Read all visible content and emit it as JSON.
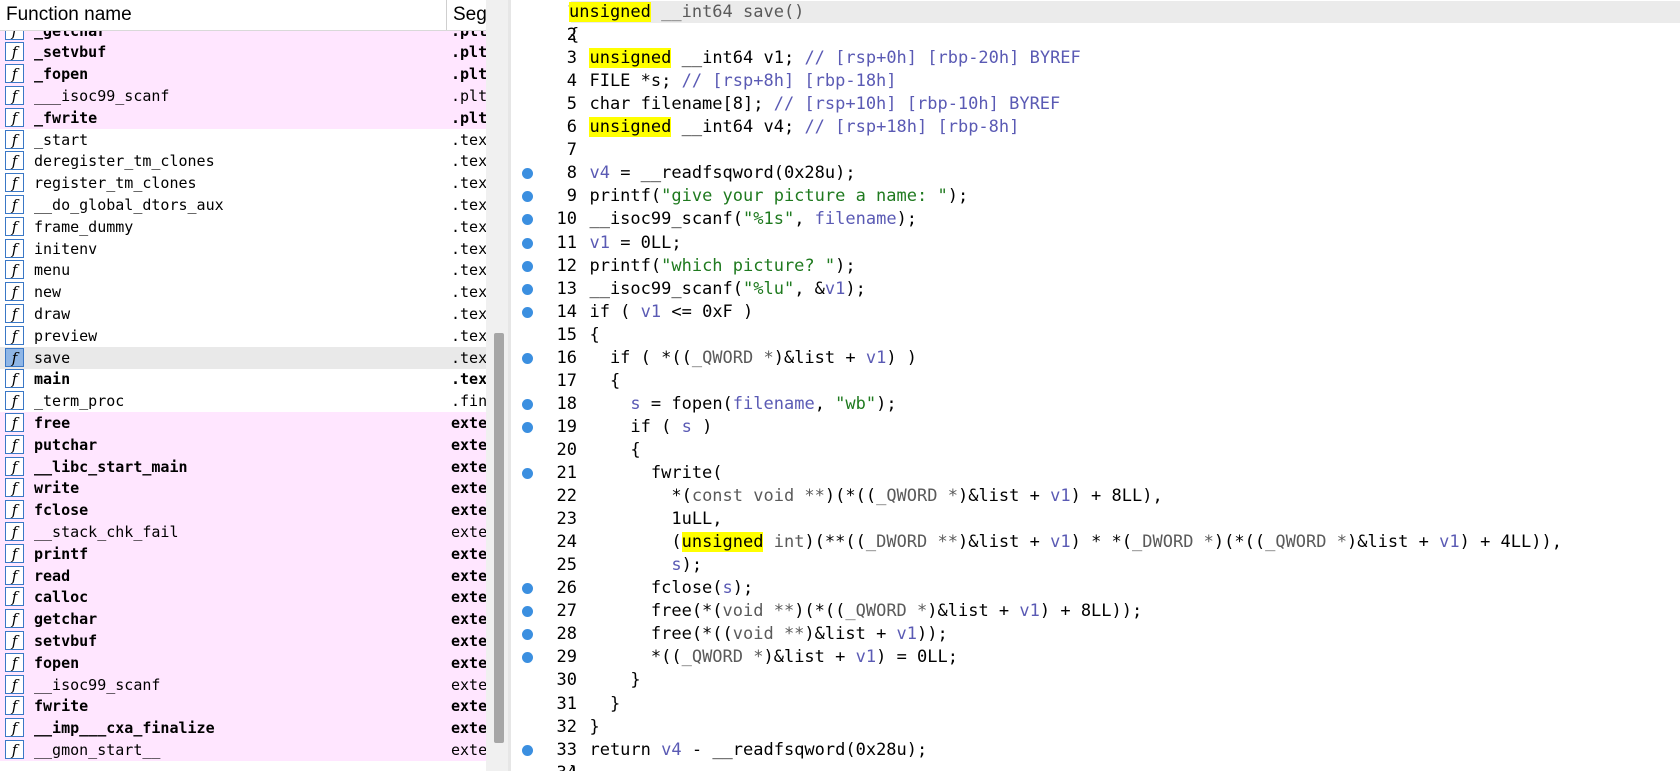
{
  "function_list": {
    "headers": {
      "name": "Function name",
      "segment": "Segment"
    },
    "rows": [
      {
        "name": "_getchar",
        "segment": ".plt",
        "bold": true,
        "style": "pink"
      },
      {
        "name": "_setvbuf",
        "segment": ".plt",
        "bold": true,
        "style": "pink"
      },
      {
        "name": "_fopen",
        "segment": ".plt",
        "bold": true,
        "style": "pink"
      },
      {
        "name": "___isoc99_scanf",
        "segment": ".plt",
        "bold": false,
        "style": "pink"
      },
      {
        "name": "_fwrite",
        "segment": ".plt",
        "bold": true,
        "style": "pink"
      },
      {
        "name": "_start",
        "segment": ".text",
        "bold": false,
        "style": "plain"
      },
      {
        "name": "deregister_tm_clones",
        "segment": ".text",
        "bold": false,
        "style": "plain"
      },
      {
        "name": "register_tm_clones",
        "segment": ".text",
        "bold": false,
        "style": "plain"
      },
      {
        "name": "__do_global_dtors_aux",
        "segment": ".text",
        "bold": false,
        "style": "plain"
      },
      {
        "name": "frame_dummy",
        "segment": ".text",
        "bold": false,
        "style": "plain"
      },
      {
        "name": "initenv",
        "segment": ".text",
        "bold": false,
        "style": "plain"
      },
      {
        "name": "menu",
        "segment": ".text",
        "bold": false,
        "style": "plain"
      },
      {
        "name": "new",
        "segment": ".text",
        "bold": false,
        "style": "plain"
      },
      {
        "name": "draw",
        "segment": ".text",
        "bold": false,
        "style": "plain"
      },
      {
        "name": "preview",
        "segment": ".text",
        "bold": false,
        "style": "plain"
      },
      {
        "name": "save",
        "segment": ".text",
        "bold": false,
        "style": "selected"
      },
      {
        "name": "main",
        "segment": ".text",
        "bold": true,
        "style": "plain"
      },
      {
        "name": "_term_proc",
        "segment": ".fini",
        "bold": false,
        "style": "plain"
      },
      {
        "name": "free",
        "segment": "extern",
        "bold": true,
        "style": "pink"
      },
      {
        "name": "putchar",
        "segment": "extern",
        "bold": true,
        "style": "pink"
      },
      {
        "name": "__libc_start_main",
        "segment": "extern",
        "bold": true,
        "style": "pink"
      },
      {
        "name": "write",
        "segment": "extern",
        "bold": true,
        "style": "pink"
      },
      {
        "name": "fclose",
        "segment": "extern",
        "bold": true,
        "style": "pink"
      },
      {
        "name": "__stack_chk_fail",
        "segment": "extern",
        "bold": false,
        "style": "pink"
      },
      {
        "name": "printf",
        "segment": "extern",
        "bold": true,
        "style": "pink"
      },
      {
        "name": "read",
        "segment": "extern",
        "bold": true,
        "style": "pink"
      },
      {
        "name": "calloc",
        "segment": "extern",
        "bold": true,
        "style": "pink"
      },
      {
        "name": "getchar",
        "segment": "extern",
        "bold": true,
        "style": "pink"
      },
      {
        "name": "setvbuf",
        "segment": "extern",
        "bold": true,
        "style": "pink"
      },
      {
        "name": "fopen",
        "segment": "extern",
        "bold": true,
        "style": "pink"
      },
      {
        "name": "__isoc99_scanf",
        "segment": "extern",
        "bold": false,
        "style": "pink"
      },
      {
        "name": "fwrite",
        "segment": "extern",
        "bold": true,
        "style": "pink"
      },
      {
        "name": "__imp___cxa_finalize",
        "segment": "extern",
        "bold": true,
        "style": "pink"
      },
      {
        "name": "__gmon_start__",
        "segment": "extern",
        "bold": false,
        "style": "pink"
      }
    ]
  },
  "pseudocode": {
    "current_line": 1,
    "lines": [
      {
        "n": "1",
        "bp": false,
        "t": [
          [
            "unsigned",
            "kwhl"
          ],
          [
            " __int64 save()",
            "typ"
          ]
        ]
      },
      {
        "n": "2",
        "bp": false,
        "t": [
          [
            "{",
            ""
          ]
        ]
      },
      {
        "n": "3",
        "bp": false,
        "t": [
          [
            "  ",
            ""
          ],
          [
            "unsigned",
            "kwhl"
          ],
          [
            " __int64 v1; ",
            ""
          ],
          [
            "// [rsp+0h] [rbp-20h] BYREF",
            "cmt"
          ]
        ]
      },
      {
        "n": "4",
        "bp": false,
        "t": [
          [
            "  FILE *s; ",
            ""
          ],
          [
            "// [rsp+8h] [rbp-18h]",
            "cmt"
          ]
        ]
      },
      {
        "n": "5",
        "bp": false,
        "t": [
          [
            "  char filename[8]; ",
            ""
          ],
          [
            "// [rsp+10h] [rbp-10h] BYREF",
            "cmt"
          ]
        ]
      },
      {
        "n": "6",
        "bp": false,
        "t": [
          [
            "  ",
            ""
          ],
          [
            "unsigned",
            "kwhl"
          ],
          [
            " __int64 v4; ",
            ""
          ],
          [
            "// [rsp+18h] [rbp-8h]",
            "cmt"
          ]
        ]
      },
      {
        "n": "7",
        "bp": false,
        "t": [
          [
            "",
            ""
          ]
        ]
      },
      {
        "n": "8",
        "bp": true,
        "t": [
          [
            "  ",
            ""
          ],
          [
            "v4",
            "var"
          ],
          [
            " = __readfsqword(0x28u);",
            ""
          ]
        ]
      },
      {
        "n": "9",
        "bp": true,
        "t": [
          [
            "  printf(",
            ""
          ],
          [
            "\"give your picture a name: \"",
            "str"
          ],
          [
            ");",
            ""
          ]
        ]
      },
      {
        "n": "10",
        "bp": true,
        "t": [
          [
            "  __isoc99_scanf(",
            ""
          ],
          [
            "\"%1s\"",
            "str"
          ],
          [
            ", ",
            ""
          ],
          [
            "filename",
            "var"
          ],
          [
            ");",
            ""
          ]
        ]
      },
      {
        "n": "11",
        "bp": true,
        "t": [
          [
            "  ",
            ""
          ],
          [
            "v1",
            "var"
          ],
          [
            " = 0LL;",
            ""
          ]
        ]
      },
      {
        "n": "12",
        "bp": true,
        "t": [
          [
            "  printf(",
            ""
          ],
          [
            "\"which picture? \"",
            "str"
          ],
          [
            ");",
            ""
          ]
        ]
      },
      {
        "n": "13",
        "bp": true,
        "t": [
          [
            "  __isoc99_scanf(",
            ""
          ],
          [
            "\"%lu\"",
            "str"
          ],
          [
            ", &",
            ""
          ],
          [
            "v1",
            "var"
          ],
          [
            ");",
            ""
          ]
        ]
      },
      {
        "n": "14",
        "bp": true,
        "t": [
          [
            "  if ( ",
            ""
          ],
          [
            "v1",
            "var"
          ],
          [
            " <= 0xF )",
            ""
          ]
        ]
      },
      {
        "n": "15",
        "bp": false,
        "t": [
          [
            "  {",
            ""
          ]
        ]
      },
      {
        "n": "16",
        "bp": true,
        "t": [
          [
            "    if ( *((",
            ""
          ],
          [
            "_QWORD *",
            "typ"
          ],
          [
            ")&list + ",
            ""
          ],
          [
            "v1",
            "var"
          ],
          [
            ") )",
            ""
          ]
        ]
      },
      {
        "n": "17",
        "bp": false,
        "t": [
          [
            "    {",
            ""
          ]
        ]
      },
      {
        "n": "18",
        "bp": true,
        "t": [
          [
            "      ",
            ""
          ],
          [
            "s",
            "var"
          ],
          [
            " = fopen(",
            ""
          ],
          [
            "filename",
            "var"
          ],
          [
            ", ",
            ""
          ],
          [
            "\"wb\"",
            "str"
          ],
          [
            ");",
            ""
          ]
        ]
      },
      {
        "n": "19",
        "bp": true,
        "t": [
          [
            "      if ( ",
            ""
          ],
          [
            "s",
            "var"
          ],
          [
            " )",
            ""
          ]
        ]
      },
      {
        "n": "20",
        "bp": false,
        "t": [
          [
            "      {",
            ""
          ]
        ]
      },
      {
        "n": "21",
        "bp": true,
        "t": [
          [
            "        fwrite(",
            ""
          ]
        ]
      },
      {
        "n": "22",
        "bp": false,
        "t": [
          [
            "          *(",
            ""
          ],
          [
            "const void **",
            "typ"
          ],
          [
            ")(*((",
            ""
          ],
          [
            "_QWORD *",
            "typ"
          ],
          [
            ")&list + ",
            ""
          ],
          [
            "v1",
            "var"
          ],
          [
            ") + 8LL),",
            ""
          ]
        ]
      },
      {
        "n": "23",
        "bp": false,
        "t": [
          [
            "          1uLL,",
            ""
          ]
        ]
      },
      {
        "n": "24",
        "bp": false,
        "t": [
          [
            "          (",
            ""
          ],
          [
            "unsigned",
            "kwhl"
          ],
          [
            " int",
            "typ"
          ],
          [
            ")(**((",
            ""
          ],
          [
            "_DWORD **",
            "typ"
          ],
          [
            ")&list + ",
            ""
          ],
          [
            "v1",
            "var"
          ],
          [
            ") * *(",
            ""
          ],
          [
            "_DWORD *",
            "typ"
          ],
          [
            ")(*((",
            ""
          ],
          [
            "_QWORD *",
            "typ"
          ],
          [
            ")&list + ",
            ""
          ],
          [
            "v1",
            "var"
          ],
          [
            ") + 4LL)),",
            ""
          ]
        ]
      },
      {
        "n": "25",
        "bp": false,
        "t": [
          [
            "          ",
            ""
          ],
          [
            "s",
            "var"
          ],
          [
            ");",
            ""
          ]
        ]
      },
      {
        "n": "26",
        "bp": true,
        "t": [
          [
            "        fclose(",
            ""
          ],
          [
            "s",
            "var"
          ],
          [
            ");",
            ""
          ]
        ]
      },
      {
        "n": "27",
        "bp": true,
        "t": [
          [
            "        free(*(",
            ""
          ],
          [
            "void **",
            "typ"
          ],
          [
            ")(*((",
            ""
          ],
          [
            "_QWORD *",
            "typ"
          ],
          [
            ")&list + ",
            ""
          ],
          [
            "v1",
            "var"
          ],
          [
            ") + 8LL));",
            ""
          ]
        ]
      },
      {
        "n": "28",
        "bp": true,
        "t": [
          [
            "        free(*((",
            ""
          ],
          [
            "void **",
            "typ"
          ],
          [
            ")&list + ",
            ""
          ],
          [
            "v1",
            "var"
          ],
          [
            "));",
            ""
          ]
        ]
      },
      {
        "n": "29",
        "bp": true,
        "t": [
          [
            "        *((",
            ""
          ],
          [
            "_QWORD *",
            "typ"
          ],
          [
            ")&list + ",
            ""
          ],
          [
            "v1",
            "var"
          ],
          [
            ") = 0LL;",
            ""
          ]
        ]
      },
      {
        "n": "30",
        "bp": false,
        "t": [
          [
            "      }",
            ""
          ]
        ]
      },
      {
        "n": "31",
        "bp": false,
        "t": [
          [
            "    }",
            ""
          ]
        ]
      },
      {
        "n": "32",
        "bp": false,
        "t": [
          [
            "  }",
            ""
          ]
        ]
      },
      {
        "n": "33",
        "bp": true,
        "t": [
          [
            "  return ",
            ""
          ],
          [
            "v4",
            "var"
          ],
          [
            " - __readfsqword(0x28u);",
            ""
          ]
        ]
      },
      {
        "n": "34",
        "bp": false,
        "t": [
          [
            "}",
            ""
          ]
        ]
      }
    ]
  }
}
